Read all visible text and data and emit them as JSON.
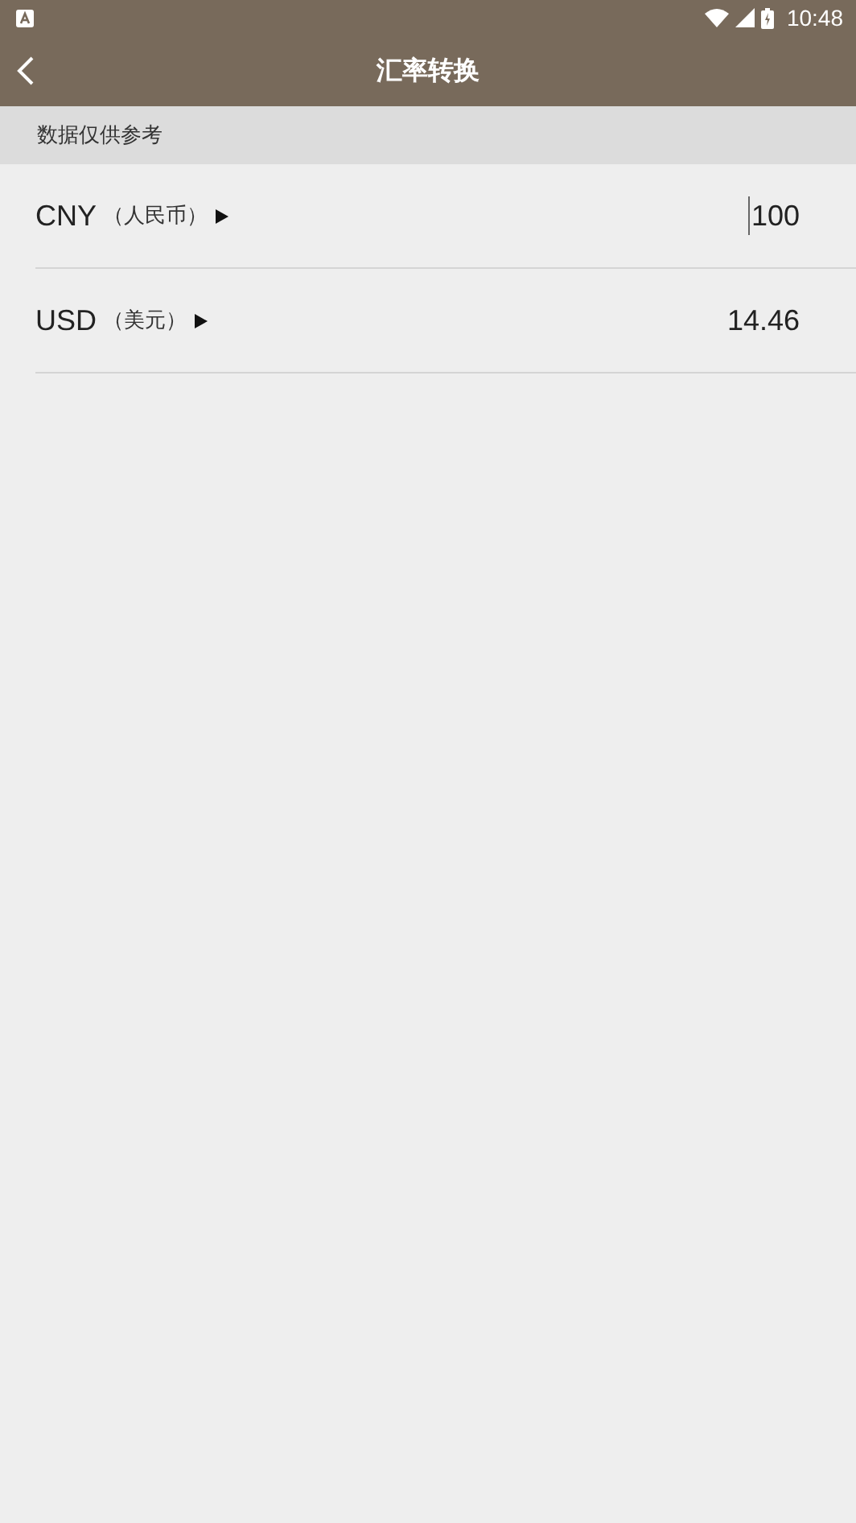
{
  "status_bar": {
    "time": "10:48"
  },
  "toolbar": {
    "title": "汇率转换"
  },
  "notice": "数据仅供参考",
  "rows": [
    {
      "code": "CNY",
      "name": "（人民币）",
      "value": "100",
      "focused": true
    },
    {
      "code": "USD",
      "name": "（美元）",
      "value": "14.46",
      "focused": false
    }
  ]
}
